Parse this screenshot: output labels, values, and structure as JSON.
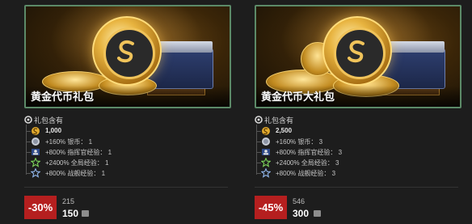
{
  "cards": [
    {
      "title": "黄金代币礼包",
      "contents_header": "礼包含有",
      "items": [
        {
          "icon": "gold-coin-icon",
          "text": "1,000"
        },
        {
          "icon": "silver-coin-icon",
          "text": "+160% 银币： 1"
        },
        {
          "icon": "commander-xp-icon",
          "text": "+800% 指挥官经验： 1"
        },
        {
          "icon": "free-xp-star-icon",
          "text": "+2400% 全局经验： 1"
        },
        {
          "icon": "ship-xp-star-icon",
          "text": "+800% 战舰经验： 1"
        }
      ],
      "discount": "-30%",
      "old_price": "215",
      "new_price": "150"
    },
    {
      "title": "黄金代币大礼包",
      "contents_header": "礼包含有",
      "items": [
        {
          "icon": "gold-coin-icon",
          "text": "2,500"
        },
        {
          "icon": "silver-coin-icon",
          "text": "+160% 银币： 3"
        },
        {
          "icon": "commander-xp-icon",
          "text": "+800% 指挥官经验： 3"
        },
        {
          "icon": "free-xp-star-icon",
          "text": "+2400% 全局经验： 3"
        },
        {
          "icon": "ship-xp-star-icon",
          "text": "+800% 战舰经验： 3"
        }
      ],
      "discount": "-45%",
      "old_price": "546",
      "new_price": "300"
    }
  ],
  "colors": {
    "frame_border": "#5c8a68",
    "discount_bg": "#b51f1f",
    "background": "#1d1d1d"
  }
}
